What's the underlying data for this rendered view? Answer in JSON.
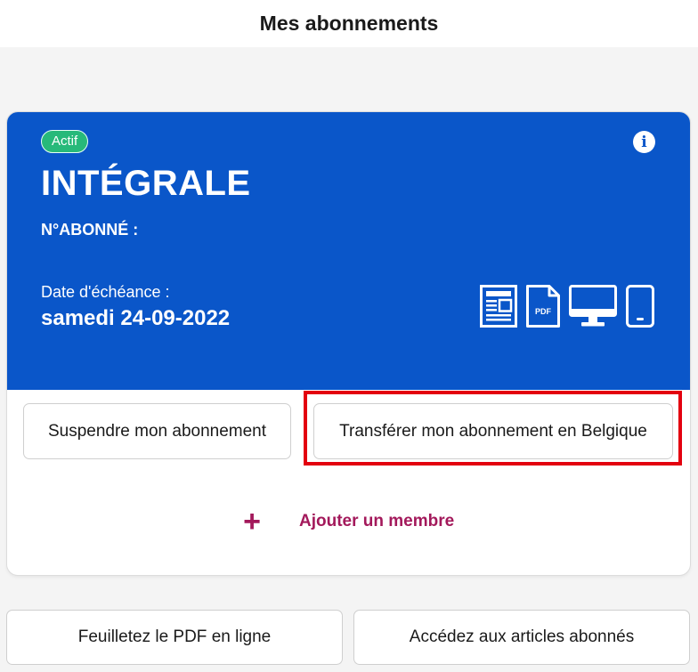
{
  "header": {
    "title": "Mes abonnements"
  },
  "subscription": {
    "status": "Actif",
    "plan": "INTÉGRALE",
    "subscriber_label": "N°ABONNÉ :",
    "due_label": "Date d'échéance :",
    "due_date": "samedi 24-09-2022",
    "formats": [
      "newspaper-icon",
      "pdf-icon",
      "desktop-icon",
      "mobile-icon"
    ],
    "pdf_icon_text": "PDF"
  },
  "actions": {
    "suspend": "Suspendre mon abonnement",
    "transfer": "Transférer mon abonnement en Belgique",
    "add_member": "Ajouter un membre"
  },
  "bottom": {
    "pdf": "Feuilletez le PDF en ligne",
    "articles": "Accédez aux articles abonnés"
  },
  "colors": {
    "card_blue": "#0a56c9",
    "status_green": "#27b97a",
    "accent_magenta": "#a3195b",
    "highlight_red": "#e3000f"
  }
}
